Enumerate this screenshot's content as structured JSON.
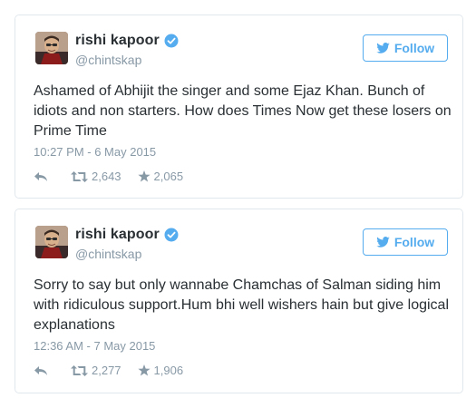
{
  "tweets": [
    {
      "display_name": "rishi kapoor",
      "handle": "@chintskap",
      "follow_label": "Follow",
      "text": "Ashamed of Abhijit the singer and some Ejaz Khan. Bunch of idiots and non starters. How does Times Now get these losers on Prime Time",
      "timestamp": "10:27 PM - 6 May 2015",
      "retweets": "2,643",
      "favorites": "2,065"
    },
    {
      "display_name": "rishi kapoor",
      "handle": "@chintskap",
      "follow_label": "Follow",
      "text": "Sorry to say but only wannabe Chamchas of Salman siding him with ridiculous support.Hum bhi well wishers hain  but give logical explanations",
      "timestamp": "12:36 AM - 7 May 2015",
      "retweets": "2,277",
      "favorites": "1,906"
    }
  ],
  "colors": {
    "accent": "#55acee",
    "muted": "#8899a6",
    "text": "#292f33",
    "border": "#e1e8ed"
  },
  "icons": {
    "verified": "verified-badge-icon",
    "follow": "twitter-bird-icon",
    "reply": "reply-icon",
    "retweet": "retweet-icon",
    "favorite": "star-icon"
  }
}
